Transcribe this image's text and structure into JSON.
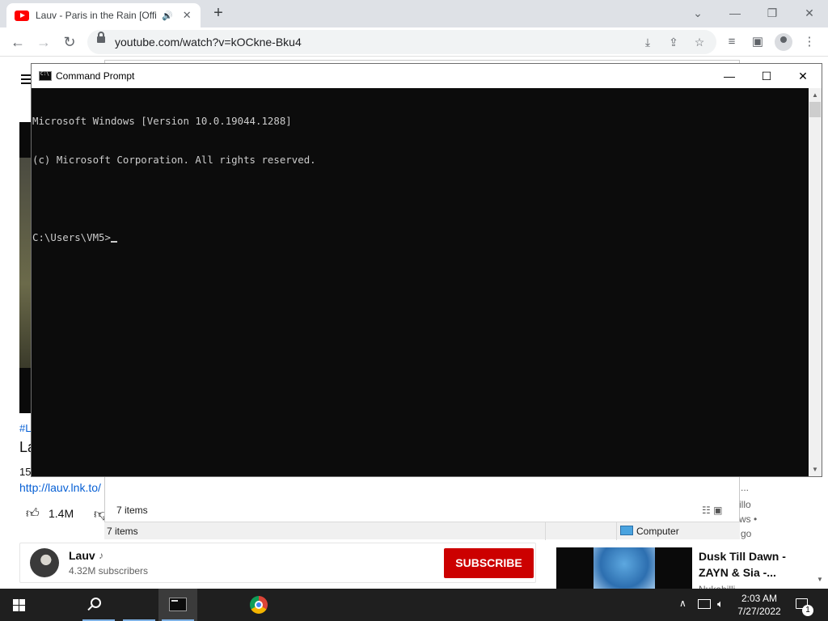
{
  "browser": {
    "tab_title": "Lauv - Paris in the Rain [Offic",
    "tab_audio_icon": "speaker-icon",
    "tab_close": "✕",
    "new_tab": "+",
    "url": "youtube.com/watch?v=kOCkne-Bku4"
  },
  "youtube": {
    "hashtag": "#L",
    "title_fragment": "La",
    "views_fragment": "15",
    "description_link": "http://lauv.lnk.to/",
    "likes": "1.4M",
    "channel": {
      "name": "Lauv",
      "subscribers": "4.32M subscribers",
      "subscribe_label": "SUBSCRIBE"
    },
    "recommended": {
      "title": "Dusk Till Dawn - ZAYN & Sia -...",
      "fragments": [
        "...",
        "illo",
        "ws •",
        "go",
        "Nukabilli..."
      ]
    }
  },
  "explorer": {
    "items_count_top": "7 items",
    "status_items": "7 items",
    "status_location": "Computer"
  },
  "cmd": {
    "title": "Command Prompt",
    "lines": [
      "Microsoft Windows [Version 10.0.19044.1288]",
      "(c) Microsoft Corporation. All rights reserved.",
      "",
      "C:\\Users\\VM5>"
    ]
  },
  "taskbar": {
    "time": "2:03 AM",
    "date": "7/27/2022",
    "notification_count": "1"
  },
  "colors": {
    "subscribe": "#cc0000",
    "link": "#065fd4",
    "cmd_background": "#0c0c0c",
    "cmd_text": "#cccccc",
    "taskbar": "#1f1f1f"
  }
}
